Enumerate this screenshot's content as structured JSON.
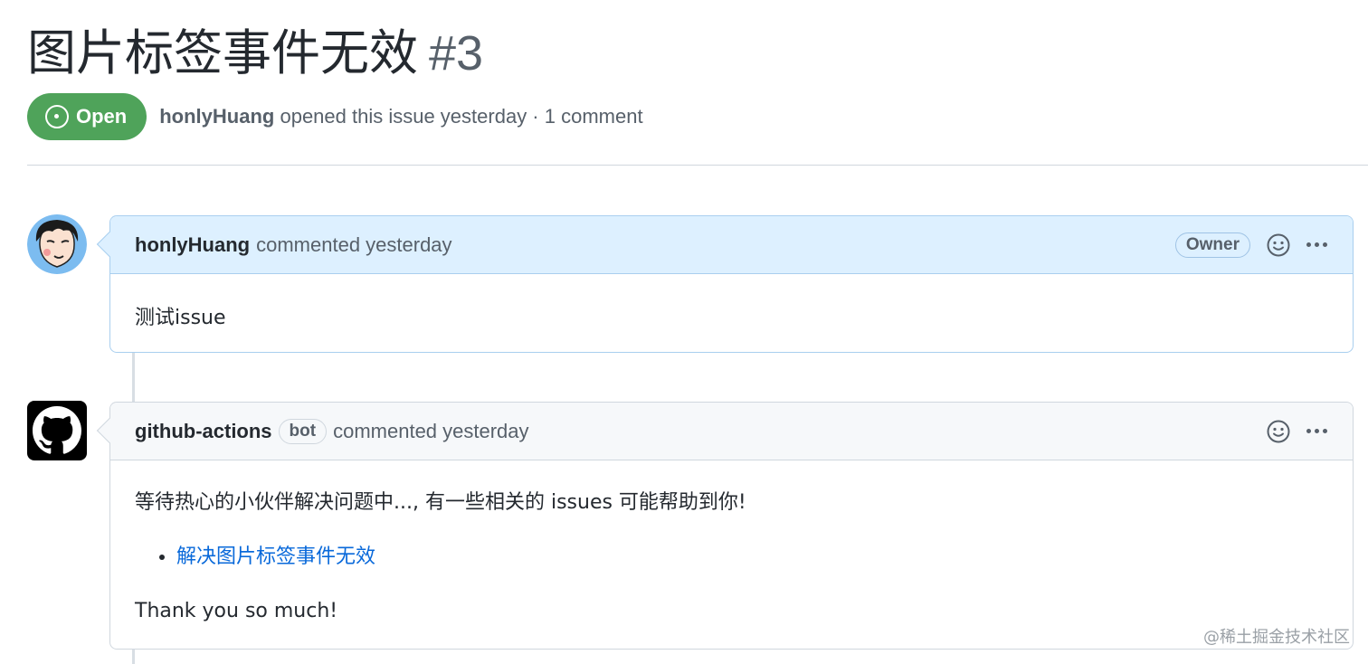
{
  "issue": {
    "title": "图片标签事件无效",
    "number": "#3",
    "state_label": "Open",
    "author": "honlyHuang",
    "opened_text": "opened this issue yesterday · 1 comment"
  },
  "comments": [
    {
      "author": "honlyHuang",
      "action": "commented yesterday",
      "badge": "Owner",
      "body_text": "测试issue"
    },
    {
      "author": "github-actions",
      "author_badge": "bot",
      "action": "commented yesterday",
      "body_intro": "等待热心的小伙伴解决问题中..., 有一些相关的 issues 可能帮助到你!",
      "links": [
        "解决图片标签事件无效"
      ],
      "body_outro": "Thank you so much!"
    }
  ],
  "watermark": "@稀土掘金技术社区",
  "colors": {
    "open_green": "#4fa35a",
    "owner_header_bg": "#ddf0ff",
    "link_blue": "#0969da"
  },
  "icons": [
    "issue-open-icon",
    "smiley-icon",
    "kebab-menu-icon",
    "github-logo-icon"
  ]
}
